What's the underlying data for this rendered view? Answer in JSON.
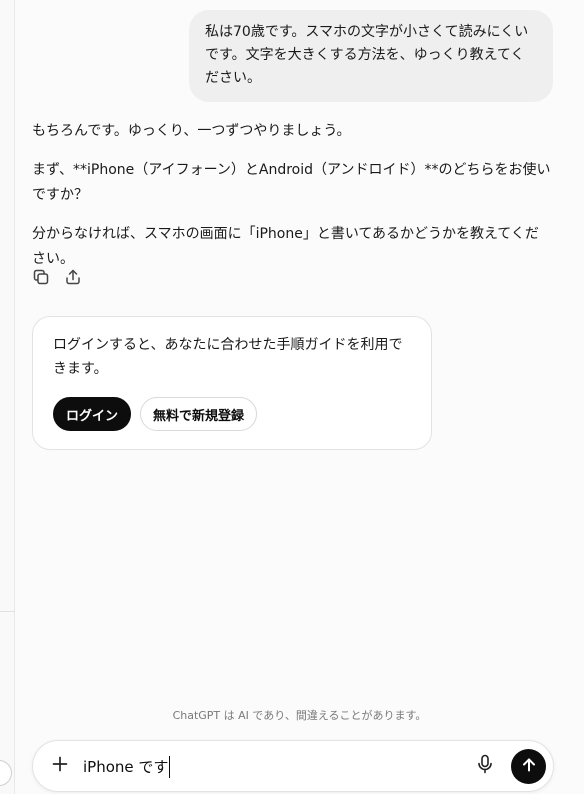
{
  "conversation": {
    "user_message": "私は70歳です。スマホの文字が小さくて読みにくいです。文字を大きくする方法を、ゆっくり教えてください。",
    "assistant_paragraphs": [
      "もちろんです。ゆっくり、一つずつやりましょう。",
      "まず、**iPhone（アイフォーン）とAndroid（アンドロイド）**のどちらをお使いですか？",
      "分からなければ、スマホの画面に「iPhone」と書いてあるかどうかを教えてください。"
    ],
    "actions": [
      {
        "name": "copy-icon"
      },
      {
        "name": "share-icon"
      }
    ]
  },
  "login_card": {
    "text": "ログインすると、あなたに合わせた手順ガイドを利用できます。",
    "login_label": "ログイン",
    "signup_label": "無料で新規登録"
  },
  "footer": {
    "disclaimer": "ChatGPT は AI であり、間違えることがあります。"
  },
  "composer": {
    "value": "iPhone です",
    "icons": [
      "plus-icon",
      "microphone-icon",
      "arrow-up-icon"
    ]
  },
  "colors": {
    "background": "#fbfbfb",
    "user_bubble": "#efefef",
    "primary_button": "#0d0d0d"
  }
}
